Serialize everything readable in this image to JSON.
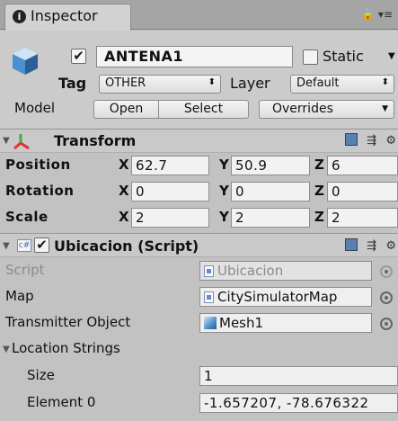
{
  "tab": {
    "label": "Inspector",
    "lock_icon": "lock-icon",
    "menu_icon": "menu-icon"
  },
  "header": {
    "active": true,
    "name": "ANTENA1",
    "static_label": "Static",
    "tag_label": "Tag",
    "tag_value": "OTHER",
    "layer_label": "Layer",
    "layer_value": "Default",
    "model_label": "Model",
    "open_label": "Open",
    "select_label": "Select",
    "overrides_label": "Overrides"
  },
  "transform": {
    "title": "Transform",
    "rows": [
      {
        "label": "Position",
        "x": "62.7",
        "y": "50.9",
        "z": "6"
      },
      {
        "label": "Rotation",
        "x": "0",
        "y": "0",
        "z": "0"
      },
      {
        "label": "Scale",
        "x": "2",
        "y": "2",
        "z": "2"
      }
    ],
    "axis": {
      "x": "X",
      "y": "Y",
      "z": "Z"
    }
  },
  "script_component": {
    "title": "Ubicacion (Script)",
    "enabled": true,
    "fields": {
      "script_label": "Script",
      "script_value": "Ubicacion",
      "map_label": "Map",
      "map_value": "CitySimulatorMap",
      "transmitter_label": "Transmitter Object",
      "transmitter_value": "Mesh1",
      "location_strings_label": "Location Strings",
      "size_label": "Size",
      "size_value": "1",
      "element0_label": "Element 0",
      "element0_value": "-1.657207, -78.676322"
    }
  },
  "colors": {
    "panel": "#c2c2c2",
    "tabbar": "#a5a5a5",
    "accent_blue": "#4b8ec9"
  }
}
